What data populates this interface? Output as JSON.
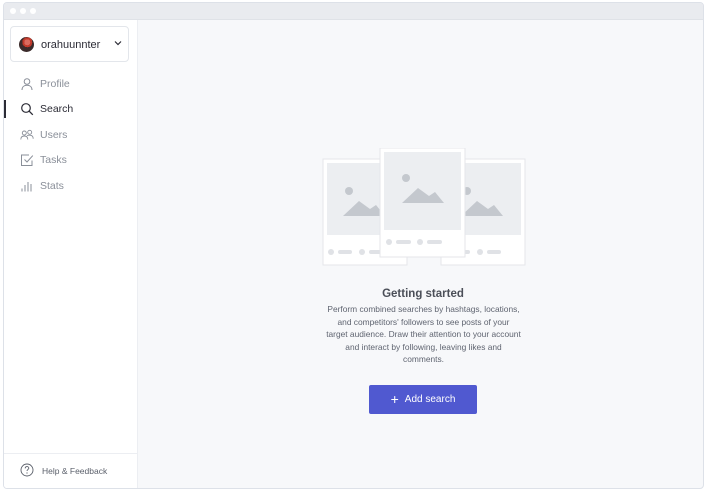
{
  "window": {
    "dots": 3
  },
  "account": {
    "username": "orahuunnter"
  },
  "sidebar": {
    "items": [
      {
        "label": "Profile",
        "icon": "user-icon",
        "active": false
      },
      {
        "label": "Search",
        "icon": "search-icon",
        "active": true
      },
      {
        "label": "Users",
        "icon": "users-icon",
        "active": false
      },
      {
        "label": "Tasks",
        "icon": "tasks-icon",
        "active": false
      },
      {
        "label": "Stats",
        "icon": "stats-icon",
        "active": false
      }
    ],
    "help_label": "Help & Feedback"
  },
  "empty_state": {
    "title": "Getting started",
    "description_lines": [
      "Perform combined searches by hashtags, locations,",
      "and competitors' followers to see posts of your",
      "target audience. Draw their attention to your account",
      "and interact by following, leaving likes and",
      "comments."
    ],
    "button_label": "Add search"
  },
  "colors": {
    "accent": "#5059d0",
    "sidebar_bg": "#ffffff",
    "main_bg": "#f7f8fa",
    "text_primary": "#2b2b35",
    "text_muted": "#8a8f99"
  }
}
